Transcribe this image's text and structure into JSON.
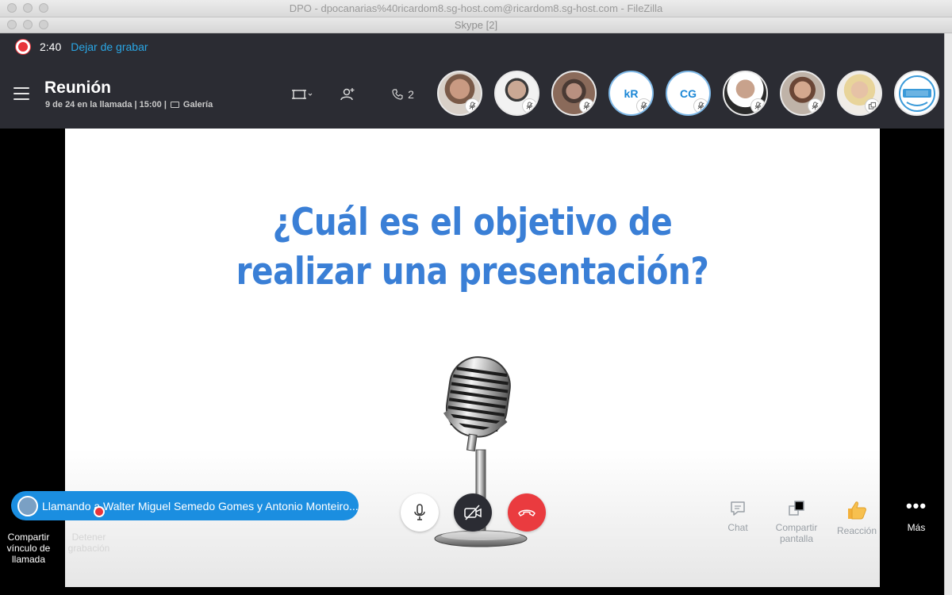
{
  "back_window": {
    "title": "DPO - dpocanarias%40ricardom8.sg-host.com@ricardom8.sg-host.com - FileZilla"
  },
  "skype_window": {
    "title": "Skype [2]"
  },
  "recording": {
    "time": "2:40",
    "stop_label": "Dejar de grabar",
    "color": "#e8343a"
  },
  "meeting": {
    "title": "Reunión",
    "subtitle_count": "9 de 24 en la llamada | 15:00 |",
    "view_label": "Galería"
  },
  "header_buttons": {
    "calls_count": "2"
  },
  "participants": [
    {
      "type": "photo",
      "icon": "mic-muted-icon"
    },
    {
      "type": "photo",
      "icon": "mic-muted-icon"
    },
    {
      "type": "photo",
      "icon": "mic-muted-icon"
    },
    {
      "type": "initials",
      "initials": "kR",
      "icon": "mic-muted-icon"
    },
    {
      "type": "initials",
      "initials": "CG",
      "icon": "mic-muted-icon"
    },
    {
      "type": "photo",
      "icon": "mic-muted-icon"
    },
    {
      "type": "photo",
      "icon": "mic-muted-icon"
    },
    {
      "type": "photo",
      "icon": "screen-share-icon"
    },
    {
      "type": "logo",
      "icon": ""
    }
  ],
  "slide": {
    "line1": "¿Cuál es el objetivo de",
    "line2": "realizar una presentación?",
    "accent": "#3a7fd6"
  },
  "calling": {
    "text": "Llamando a Walter Miguel Semedo Gomes y Antonio Monteiro..."
  },
  "bottom_left": {
    "share_link_line1": "Compartir",
    "share_link_line2": "vínculo de",
    "share_link_line3": "llamada",
    "stop_rec_line1": "Detener",
    "stop_rec_line2": "grabación"
  },
  "bottom_right": {
    "chat": "Chat",
    "share_screen_line1": "Compartir",
    "share_screen_line2": "pantalla",
    "reaction": "Reacción",
    "more": "Más"
  },
  "colors": {
    "header_bg": "#2b2c33",
    "brand_blue": "#1b8ee0",
    "hangup": "#ea3b3f"
  }
}
